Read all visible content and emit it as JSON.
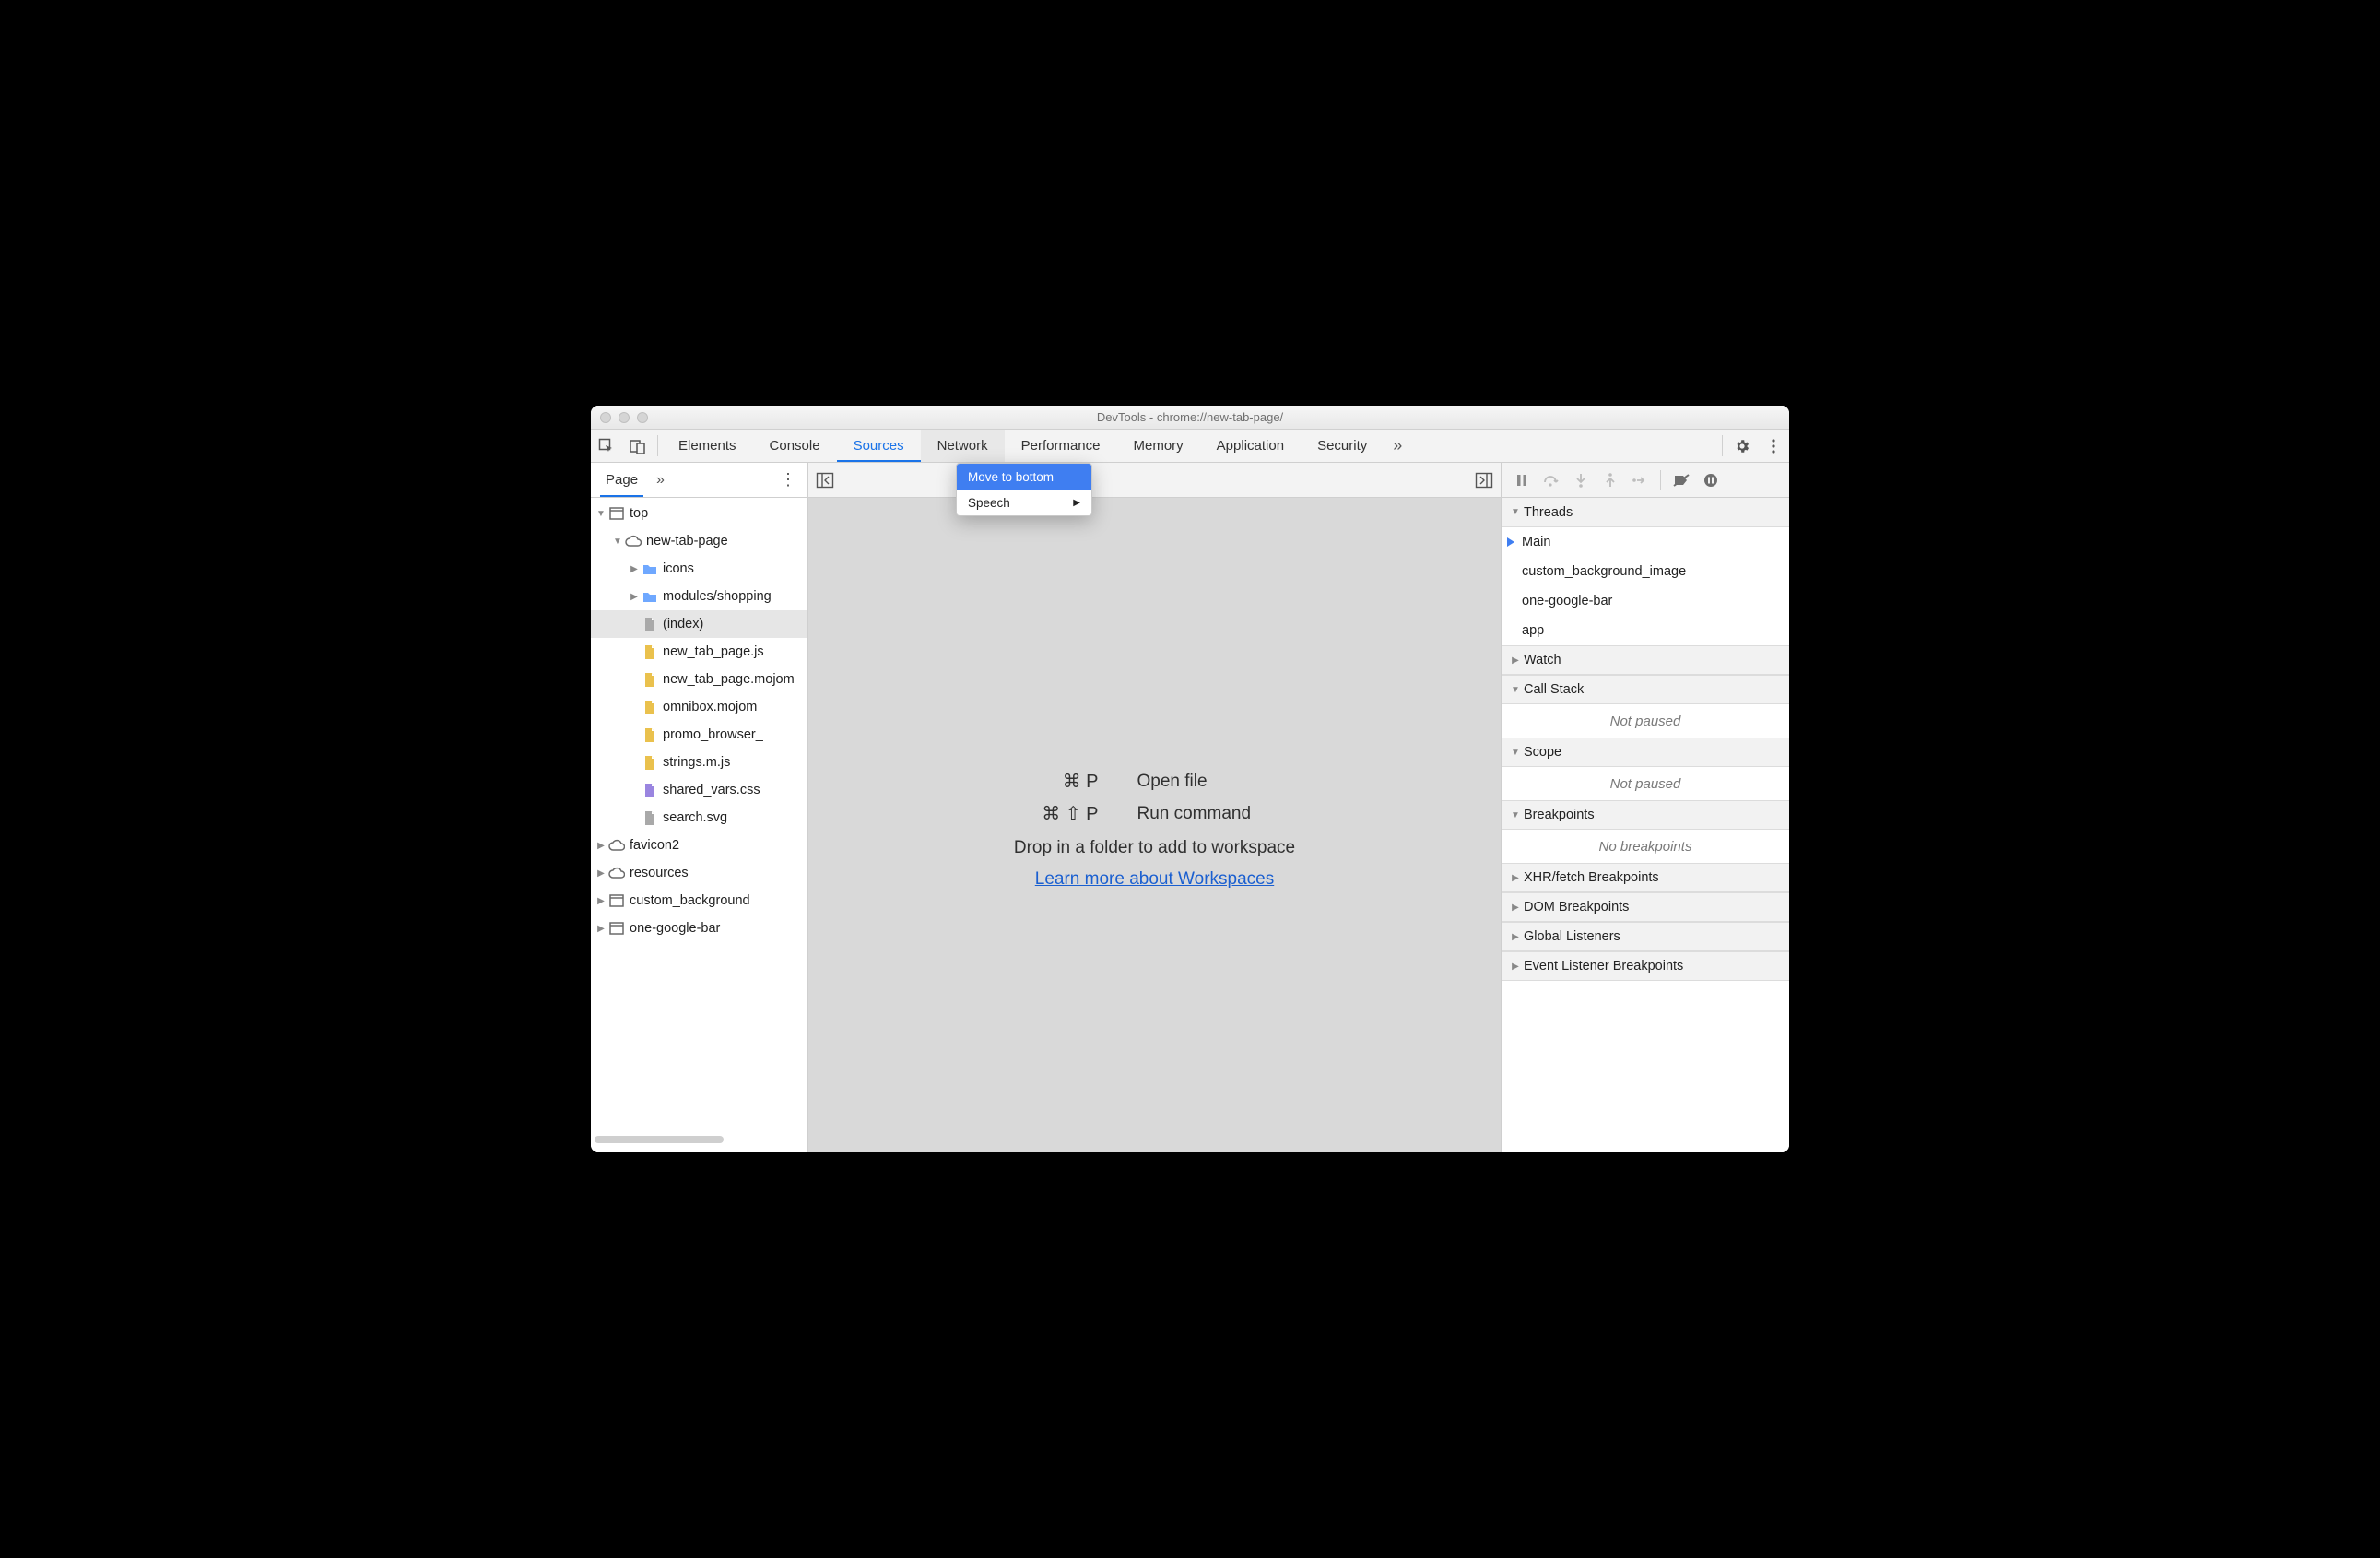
{
  "window": {
    "title": "DevTools - chrome://new-tab-page/"
  },
  "tabs": {
    "items": [
      "Elements",
      "Console",
      "Sources",
      "Network",
      "Performance",
      "Memory",
      "Application",
      "Security"
    ],
    "active": 2,
    "highlighted": 3
  },
  "contextMenu": {
    "items": [
      {
        "label": "Move to bottom",
        "highlighted": true,
        "submenu": false
      },
      {
        "label": "Speech",
        "highlighted": false,
        "submenu": true
      }
    ]
  },
  "leftPanel": {
    "tab": "Page",
    "tree": [
      {
        "depth": 0,
        "arrow": "down",
        "icon": "frame",
        "label": "top"
      },
      {
        "depth": 1,
        "arrow": "down",
        "icon": "cloud",
        "label": "new-tab-page"
      },
      {
        "depth": 2,
        "arrow": "right",
        "icon": "folder",
        "label": "icons"
      },
      {
        "depth": 2,
        "arrow": "right",
        "icon": "folder",
        "label": "modules/shopping"
      },
      {
        "depth": 2,
        "arrow": "",
        "icon": "doc",
        "label": "(index)",
        "selected": true
      },
      {
        "depth": 2,
        "arrow": "",
        "icon": "js",
        "label": "new_tab_page.js"
      },
      {
        "depth": 2,
        "arrow": "",
        "icon": "js",
        "label": "new_tab_page.mojom"
      },
      {
        "depth": 2,
        "arrow": "",
        "icon": "js",
        "label": "omnibox.mojom"
      },
      {
        "depth": 2,
        "arrow": "",
        "icon": "js",
        "label": "promo_browser_"
      },
      {
        "depth": 2,
        "arrow": "",
        "icon": "js",
        "label": "strings.m.js"
      },
      {
        "depth": 2,
        "arrow": "",
        "icon": "css",
        "label": "shared_vars.css"
      },
      {
        "depth": 2,
        "arrow": "",
        "icon": "doc",
        "label": "search.svg"
      },
      {
        "depth": 0,
        "arrow": "right",
        "icon": "cloud",
        "label": "favicon2"
      },
      {
        "depth": 0,
        "arrow": "right",
        "icon": "cloud",
        "label": "resources"
      },
      {
        "depth": 0,
        "arrow": "right",
        "icon": "frame",
        "label": "custom_background"
      },
      {
        "depth": 0,
        "arrow": "right",
        "icon": "frame",
        "label": "one-google-bar"
      }
    ]
  },
  "centerPanel": {
    "shortcuts": [
      {
        "keys": "⌘ P",
        "label": "Open file"
      },
      {
        "keys": "⌘ ⇧ P",
        "label": "Run command"
      }
    ],
    "hint": "Drop in a folder to add to workspace",
    "link": "Learn more about Workspaces"
  },
  "rightPanel": {
    "sections": [
      {
        "title": "Threads",
        "expanded": true,
        "threads": [
          {
            "label": "Main",
            "active": true
          },
          {
            "label": "custom_background_image",
            "active": false
          },
          {
            "label": "one-google-bar",
            "active": false
          },
          {
            "label": "app",
            "active": false
          }
        ]
      },
      {
        "title": "Watch",
        "expanded": false
      },
      {
        "title": "Call Stack",
        "expanded": true,
        "empty": "Not paused"
      },
      {
        "title": "Scope",
        "expanded": true,
        "empty": "Not paused"
      },
      {
        "title": "Breakpoints",
        "expanded": true,
        "empty": "No breakpoints"
      },
      {
        "title": "XHR/fetch Breakpoints",
        "expanded": false
      },
      {
        "title": "DOM Breakpoints",
        "expanded": false
      },
      {
        "title": "Global Listeners",
        "expanded": false
      },
      {
        "title": "Event Listener Breakpoints",
        "expanded": false
      }
    ]
  }
}
